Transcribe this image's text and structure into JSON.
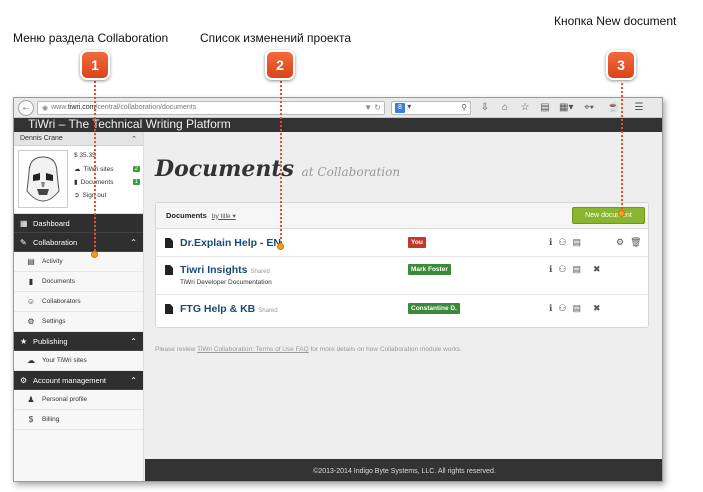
{
  "callouts": [
    {
      "num": "1",
      "label": "Меню раздела Collaboration"
    },
    {
      "num": "2",
      "label": "Список изменений проекта"
    },
    {
      "num": "3",
      "label": "Кнопка New document"
    }
  ],
  "browser": {
    "url_prefix": "www.",
    "url_host": "tiwri.com",
    "url_path": "/central/collaboration/documents",
    "search_engine": "8",
    "icons": [
      "download-icon",
      "home-icon",
      "star-icon",
      "clipboard-icon",
      "grid-icon",
      "crop-icon",
      "menu-icon"
    ]
  },
  "app": {
    "title": "TiWri – The Technical Writing Platform"
  },
  "sidebar": {
    "user_name": "Dennis Crane",
    "balance": "$ 35.35",
    "tiwri_sites_label": "TiWri sites",
    "tiwri_sites_count": "2",
    "documents_label": "Documents",
    "documents_count": "1",
    "sign_out": "Sign out",
    "dashboard": "Dashboard",
    "collaboration": "Collaboration",
    "collab_items": [
      "Activity",
      "Documents",
      "Collaborators",
      "Settings"
    ],
    "publishing": "Publishing",
    "publishing_items": [
      "Your TiWri sites"
    ],
    "account": "Account management",
    "account_items": [
      "Personal profile",
      "Billing"
    ]
  },
  "main": {
    "title": "Documents",
    "subtitle": "at Collaboration",
    "panel_title": "Documents",
    "sort_label": "by title",
    "new_doc_button": "New document",
    "documents": [
      {
        "title": "Dr.Explain Help - EN",
        "shared": "",
        "desc": "",
        "owner": "You",
        "owner_type": "me"
      },
      {
        "title": "Tiwri Insights",
        "shared": "Shared",
        "desc": "TiWri Developer Documentation",
        "owner": "Mark Foster",
        "owner_type": "other"
      },
      {
        "title": "FTG Help & KB",
        "shared": "Shared",
        "desc": "",
        "owner": "Constantine D.",
        "owner_type": "other"
      }
    ],
    "review_prefix": "Please review",
    "review_link": "TiWri Collaboration: Terms of Use FAQ",
    "review_suffix": "for more details on how Collaboration module works."
  },
  "footer": {
    "text": "©2013-2014 Indigo Byte Systems, LLC. All rights reserved."
  },
  "colors": {
    "callout": "#e8522a",
    "new_doc_button": "#8ab52e",
    "owner_me": "#c0392b",
    "owner_other": "#3a8a3a",
    "dark_nav": "#2f2f2f"
  }
}
